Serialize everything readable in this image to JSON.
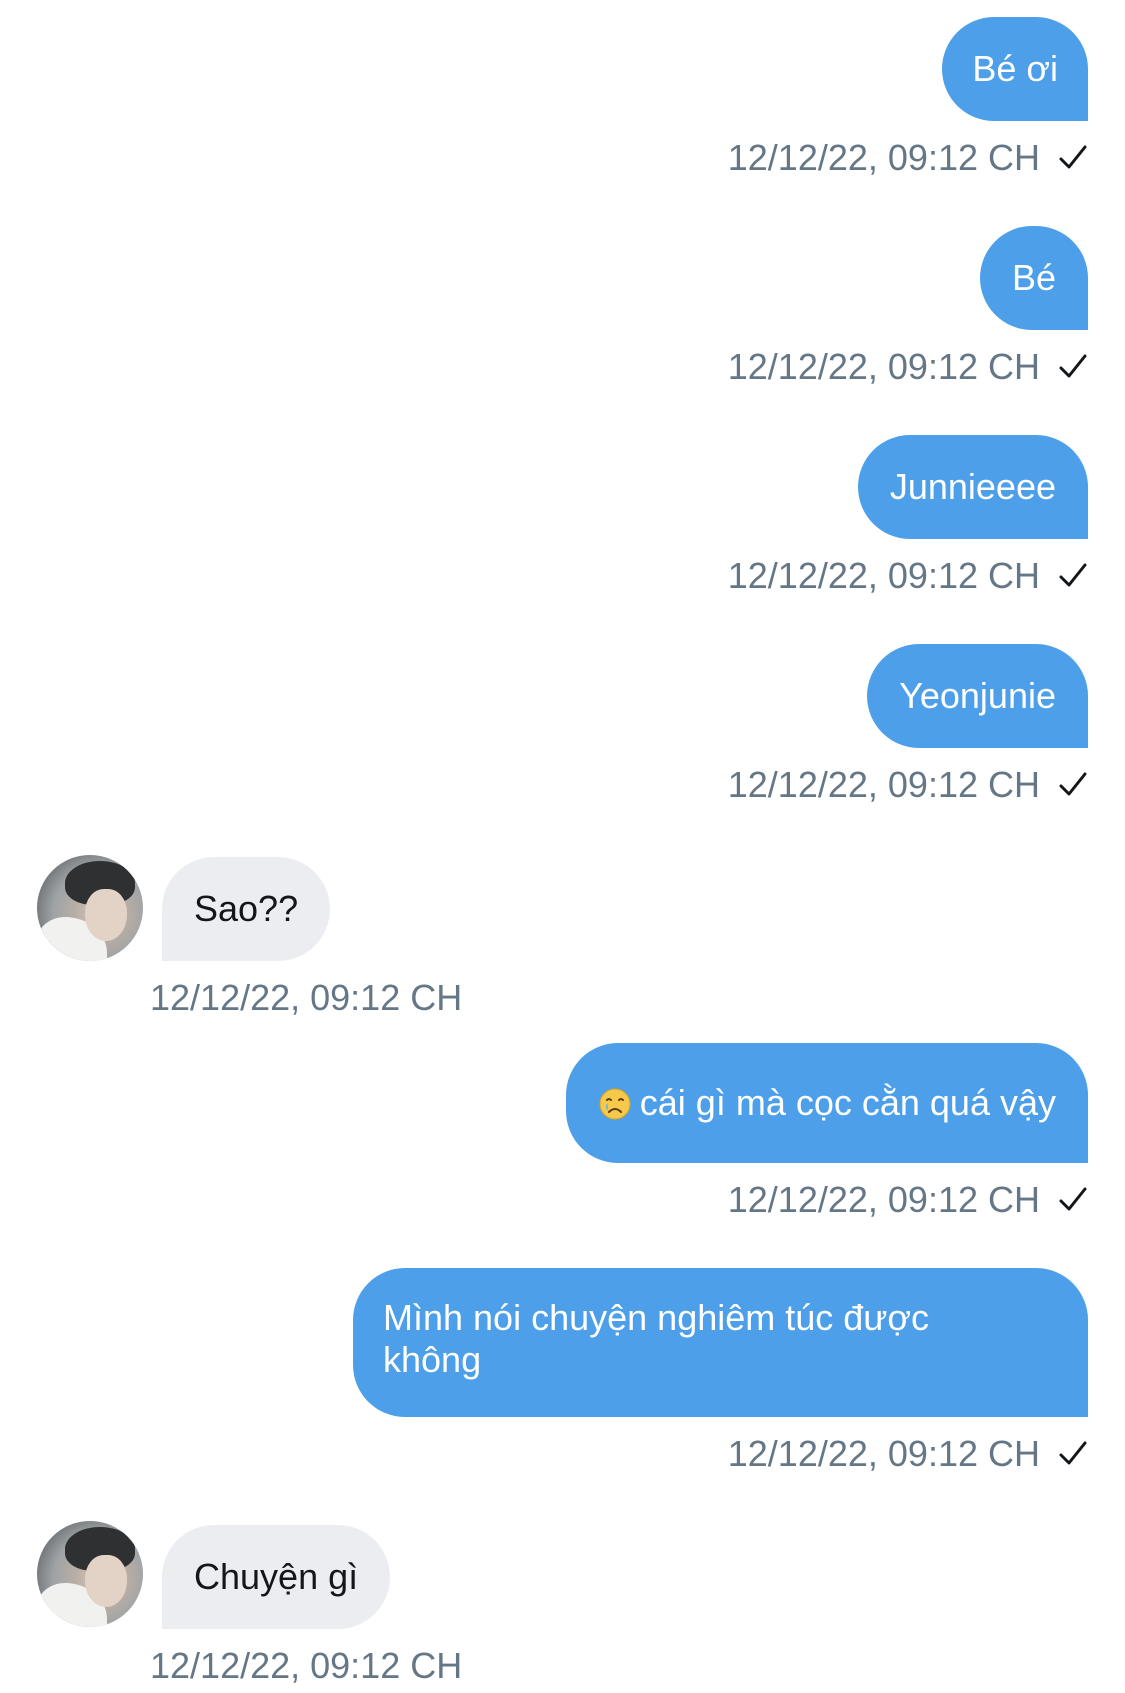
{
  "conversation": {
    "messages": [
      {
        "direction": "outgoing",
        "text": "Bé ơi",
        "timestamp": "12/12/22, 09:12 CH",
        "status_icon": "checkmark-icon"
      },
      {
        "direction": "outgoing",
        "text": "Bé",
        "timestamp": "12/12/22, 09:12 CH",
        "status_icon": "checkmark-icon"
      },
      {
        "direction": "outgoing",
        "text": "Junnieeee",
        "timestamp": "12/12/22, 09:12 CH",
        "status_icon": "checkmark-icon"
      },
      {
        "direction": "outgoing",
        "text": "Yeonjunie",
        "timestamp": "12/12/22, 09:12 CH",
        "status_icon": "checkmark-icon"
      },
      {
        "direction": "incoming",
        "text": "Sao??",
        "timestamp": "12/12/22, 09:12 CH",
        "avatar": "avatar"
      },
      {
        "direction": "outgoing",
        "emoji": "crying-face-emoji",
        "text": "cái gì mà cọc cằn quá vậy",
        "timestamp": "12/12/22, 09:12 CH",
        "status_icon": "checkmark-icon"
      },
      {
        "direction": "outgoing",
        "text": "Mình nói chuyện nghiêm túc được không",
        "timestamp": "12/12/22, 09:12 CH",
        "status_icon": "checkmark-icon"
      },
      {
        "direction": "incoming",
        "text": "Chuyện gì",
        "timestamp": "12/12/22, 09:12 CH",
        "avatar": "avatar"
      }
    ]
  },
  "colors": {
    "outgoing_bubble": "#4c9fe8",
    "incoming_bubble": "#ebedf0",
    "timestamp_text": "#657786",
    "outgoing_text": "#ffffff",
    "incoming_text": "#14171a"
  }
}
